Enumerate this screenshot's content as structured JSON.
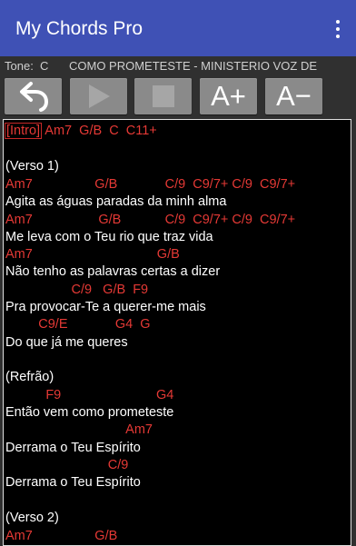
{
  "app": {
    "title": "My Chords Pro",
    "menu_icon": "more-vert-icon"
  },
  "info": {
    "tone_label": "Tone:",
    "tone_value": "C",
    "song_title": "COMO PROMETESTE - MINISTERIO VOZ DE"
  },
  "toolbar": {
    "back_icon": "undo-arrow-icon",
    "play_icon": "play-icon",
    "stop_icon": "stop-icon",
    "increase_label": "A+",
    "decrease_label": "A−"
  },
  "colors": {
    "appbar": "#3f51b5",
    "background": "#303030",
    "chord": "#e53935",
    "lyric": "#ffffff",
    "button": "#8a8a8a"
  },
  "sheet": {
    "intro_tag": "[Intro]",
    "intro_chords": " Am7  G/B  C  C11+",
    "verse1": "(Verso 1)",
    "c1": "Am7                 G/B             C/9  C9/7+ C/9  C9/7+",
    "l1": "Agita as águas paradas da minh alma",
    "c2": "Am7                  G/B            C/9  C9/7+ C/9  C9/7+",
    "l2": "Me leva com o Teu rio que traz vida",
    "c3": "Am7                                  G/B",
    "l3": "Não tenho as palavras certas a dizer",
    "c4": "                  C/9   G/B  F9",
    "l4": "Pra provocar-Te a querer-me mais",
    "c5": "         C9/E             G4  G",
    "l5": "Do que já me queres",
    "chorus": "(Refrão)",
    "c6": "           F9                          G4",
    "l6": "Então vem como prometeste",
    "c7": "                                 Am7",
    "l7": "Derrama o Teu Espírito",
    "c8": "                            C/9",
    "l8": "Derrama o Teu Espírito",
    "verse2": "(Verso 2)",
    "c9": "Am7                 G/B"
  }
}
